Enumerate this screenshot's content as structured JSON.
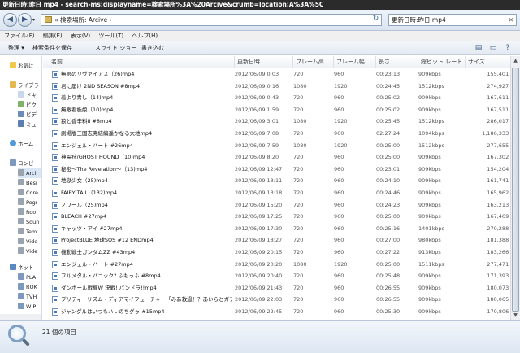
{
  "title": "更新日時:昨日 mp4 - search-ms:displayname=検索場所%3A%20Arcive&crumb=location:A%3A%5C",
  "address": "« 検索場所: Arcive ›",
  "search": {
    "value": "更新日時:昨日 mp4"
  },
  "menu": [
    "ファイル(F)",
    "編集(E)",
    "表示(V)",
    "ツール(T)",
    "ヘルプ(H)"
  ],
  "toolbar": {
    "organize": "整理 ▾",
    "save_search": "検索条件を保存",
    "slideshow": "スライド ショー",
    "burn": "書き込む"
  },
  "sidebar": [
    {
      "label": "お気に",
      "icon": "star-icon"
    },
    {
      "label": "ライブラ",
      "icon": "library-icon"
    },
    {
      "label": "ドキ",
      "icon": "documents-icon"
    },
    {
      "label": "ピク",
      "icon": "pictures-icon"
    },
    {
      "label": "ビデ",
      "icon": "videos-icon"
    },
    {
      "label": "ミュー",
      "icon": "music-icon"
    },
    {
      "label": "ホーム",
      "icon": "homegroup-icon"
    },
    {
      "label": "コンピ",
      "icon": "computer-icon"
    },
    {
      "label": "Arci",
      "icon": "drive-icon"
    },
    {
      "label": "Besi",
      "icon": "drive-icon"
    },
    {
      "label": "Core",
      "icon": "drive-icon"
    },
    {
      "label": "Pogr",
      "icon": "drive-icon"
    },
    {
      "label": "Roo",
      "icon": "drive-icon"
    },
    {
      "label": "Soun",
      "icon": "drive-icon"
    },
    {
      "label": "Tem",
      "icon": "drive-icon"
    },
    {
      "label": "Vide",
      "icon": "drive-icon"
    },
    {
      "label": "Vide",
      "icon": "drive-icon"
    },
    {
      "label": "ネット",
      "icon": "network-icon"
    },
    {
      "label": "PLA",
      "icon": "pc-icon"
    },
    {
      "label": "ROK",
      "icon": "pc-icon"
    },
    {
      "label": "TVH",
      "icon": "pc-icon"
    },
    {
      "label": "WIP",
      "icon": "pc-icon"
    }
  ],
  "columns": {
    "name": "名前",
    "date": "更新日時",
    "fh": "フレーム高",
    "fw": "フレーム幅",
    "len": "長さ",
    "br": "総ビット レート",
    "size": "サイズ"
  },
  "rows": [
    {
      "name": "無限のリヴァイアス（26)mp4",
      "date": "2012/06/09 0:03",
      "fh": "720",
      "fw": "960",
      "len": "00:23:13",
      "br": "909kbps",
      "size": "155,401 KB"
    },
    {
      "name": "君に届け 2ND SEASON #8mp4",
      "date": "2012/06/09 0:16",
      "fh": "1080",
      "fw": "1920",
      "len": "00:24:45",
      "br": "1512kbps",
      "size": "274,927 KB"
    },
    {
      "name": "着より青し（14)mp4",
      "date": "2012/06/09 0:43",
      "fh": "720",
      "fw": "960",
      "len": "00:25:02",
      "br": "909kbps",
      "size": "167,611 KB"
    },
    {
      "name": "無敵看板娘（10)mp4",
      "date": "2012/06/09 1:59",
      "fh": "720",
      "fw": "960",
      "len": "00:25:02",
      "br": "909kbps",
      "size": "167,511 KB"
    },
    {
      "name": "狼と香辛料II #8mp4",
      "date": "2012/06/09 3:01",
      "fh": "1080",
      "fw": "1920",
      "len": "00:25:45",
      "br": "1512kbps",
      "size": "286,017 KB"
    },
    {
      "name": "劇場版三国志完結編遥かなる大地mp4",
      "date": "2012/06/09 7:08",
      "fh": "720",
      "fw": "960",
      "len": "02:27:24",
      "br": "1094kbps",
      "size": "1,186,333 KB"
    },
    {
      "name": "エンジェル・ハート #26mp4",
      "date": "2012/06/09 7:59",
      "fh": "1080",
      "fw": "1920",
      "len": "00:25:00",
      "br": "1512kbps",
      "size": "277,655 KB"
    },
    {
      "name": "神霊狩/GHOST HOUND（10)mp4",
      "date": "2012/06/09 8:20",
      "fh": "720",
      "fw": "960",
      "len": "00:25:00",
      "br": "909kbps",
      "size": "167,302 KB"
    },
    {
      "name": "秘密〜The Revelation〜（13)mp4",
      "date": "2012/06/09 12:47",
      "fh": "720",
      "fw": "960",
      "len": "00:23:01",
      "br": "909kbps",
      "size": "154,204 KB"
    },
    {
      "name": "地獄少女（25)mp4",
      "date": "2012/06/09 13:11",
      "fh": "720",
      "fw": "960",
      "len": "00:24:10",
      "br": "909kbps",
      "size": "161,741 KB"
    },
    {
      "name": "FAIRY TAIL（132)mp4",
      "date": "2012/06/09 13:18",
      "fh": "720",
      "fw": "960",
      "len": "00:24:46",
      "br": "909kbps",
      "size": "165,962 KB"
    },
    {
      "name": "ノワール（25)mp4",
      "date": "2012/06/09 15:20",
      "fh": "720",
      "fw": "960",
      "len": "00:24:23",
      "br": "909kbps",
      "size": "163,213 KB"
    },
    {
      "name": "BLEACH #27mp4",
      "date": "2012/06/09 17:25",
      "fh": "720",
      "fw": "960",
      "len": "00:25:00",
      "br": "909kbps",
      "size": "167,469 KB"
    },
    {
      "name": "キャッツ・アイ #27mp4",
      "date": "2012/06/09 17:30",
      "fh": "720",
      "fw": "960",
      "len": "00:25:16",
      "br": "1401kbps",
      "size": "270,288 KB"
    },
    {
      "name": "ProjectBLUE 地球SOS #12 ENDmp4",
      "date": "2012/06/09 18:27",
      "fh": "720",
      "fw": "960",
      "len": "00:27:00",
      "br": "980kbps",
      "size": "181,388 KB"
    },
    {
      "name": "機動戦士ガンダムZZ #43mp4",
      "date": "2012/06/09 20:15",
      "fh": "720",
      "fw": "960",
      "len": "00:27:22",
      "br": "913kbps",
      "size": "183,266 KB"
    },
    {
      "name": "エンジェル・ハート #27mp4",
      "date": "2012/06/09 20:20",
      "fh": "1080",
      "fw": "1920",
      "len": "00:25:00",
      "br": "1511kbps",
      "size": "277,471 KB"
    },
    {
      "name": "フルメタル・パニック? ふもっふ #8mp4",
      "date": "2012/06/09 20:40",
      "fh": "720",
      "fw": "960",
      "len": "00:25:48",
      "br": "909kbps",
      "size": "171,393 KB"
    },
    {
      "name": "ダンボール戦機W 決戦! パンドラ!!mp4",
      "date": "2012/06/09 21:43",
      "fh": "720",
      "fw": "960",
      "len": "00:26:55",
      "br": "909kbps",
      "size": "180,073 KB"
    },
    {
      "name": "プリティーリズム・ディアマイフューチャー「みあ救過！？あいらとガチバ...",
      "date": "2012/06/09 22:03",
      "fh": "720",
      "fw": "960",
      "len": "00:26:55",
      "br": "909kbps",
      "size": "180,065 KB"
    },
    {
      "name": "ジャングルはいつもハレのちグゥ #15mp4",
      "date": "2012/06/09 22:45",
      "fh": "720",
      "fw": "960",
      "len": "00:25:30",
      "br": "909kbps",
      "size": "170,806 KB"
    }
  ],
  "status": {
    "count": "21 個の項目"
  }
}
